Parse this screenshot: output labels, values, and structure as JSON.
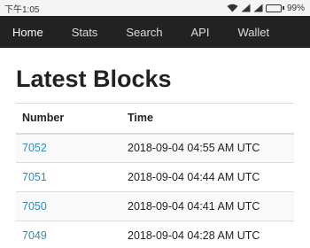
{
  "status_bar": {
    "time": "下午1:05",
    "battery": "99%",
    "battery_level": 0.99
  },
  "nav": {
    "items": [
      {
        "label": "Home",
        "active": true
      },
      {
        "label": "Stats"
      },
      {
        "label": "Search"
      },
      {
        "label": "API"
      },
      {
        "label": "Wallet"
      }
    ]
  },
  "page": {
    "title": "Latest Blocks",
    "link_color": "#2a8fbd"
  },
  "table": {
    "headers": [
      "Number",
      "Time"
    ],
    "rows": [
      {
        "number": "7052",
        "time": "2018-09-04 04:55 AM UTC"
      },
      {
        "number": "7051",
        "time": "2018-09-04 04:44 AM UTC"
      },
      {
        "number": "7050",
        "time": "2018-09-04 04:41 AM UTC"
      },
      {
        "number": "7049",
        "time": "2018-09-04 04:28 AM UTC"
      }
    ]
  }
}
